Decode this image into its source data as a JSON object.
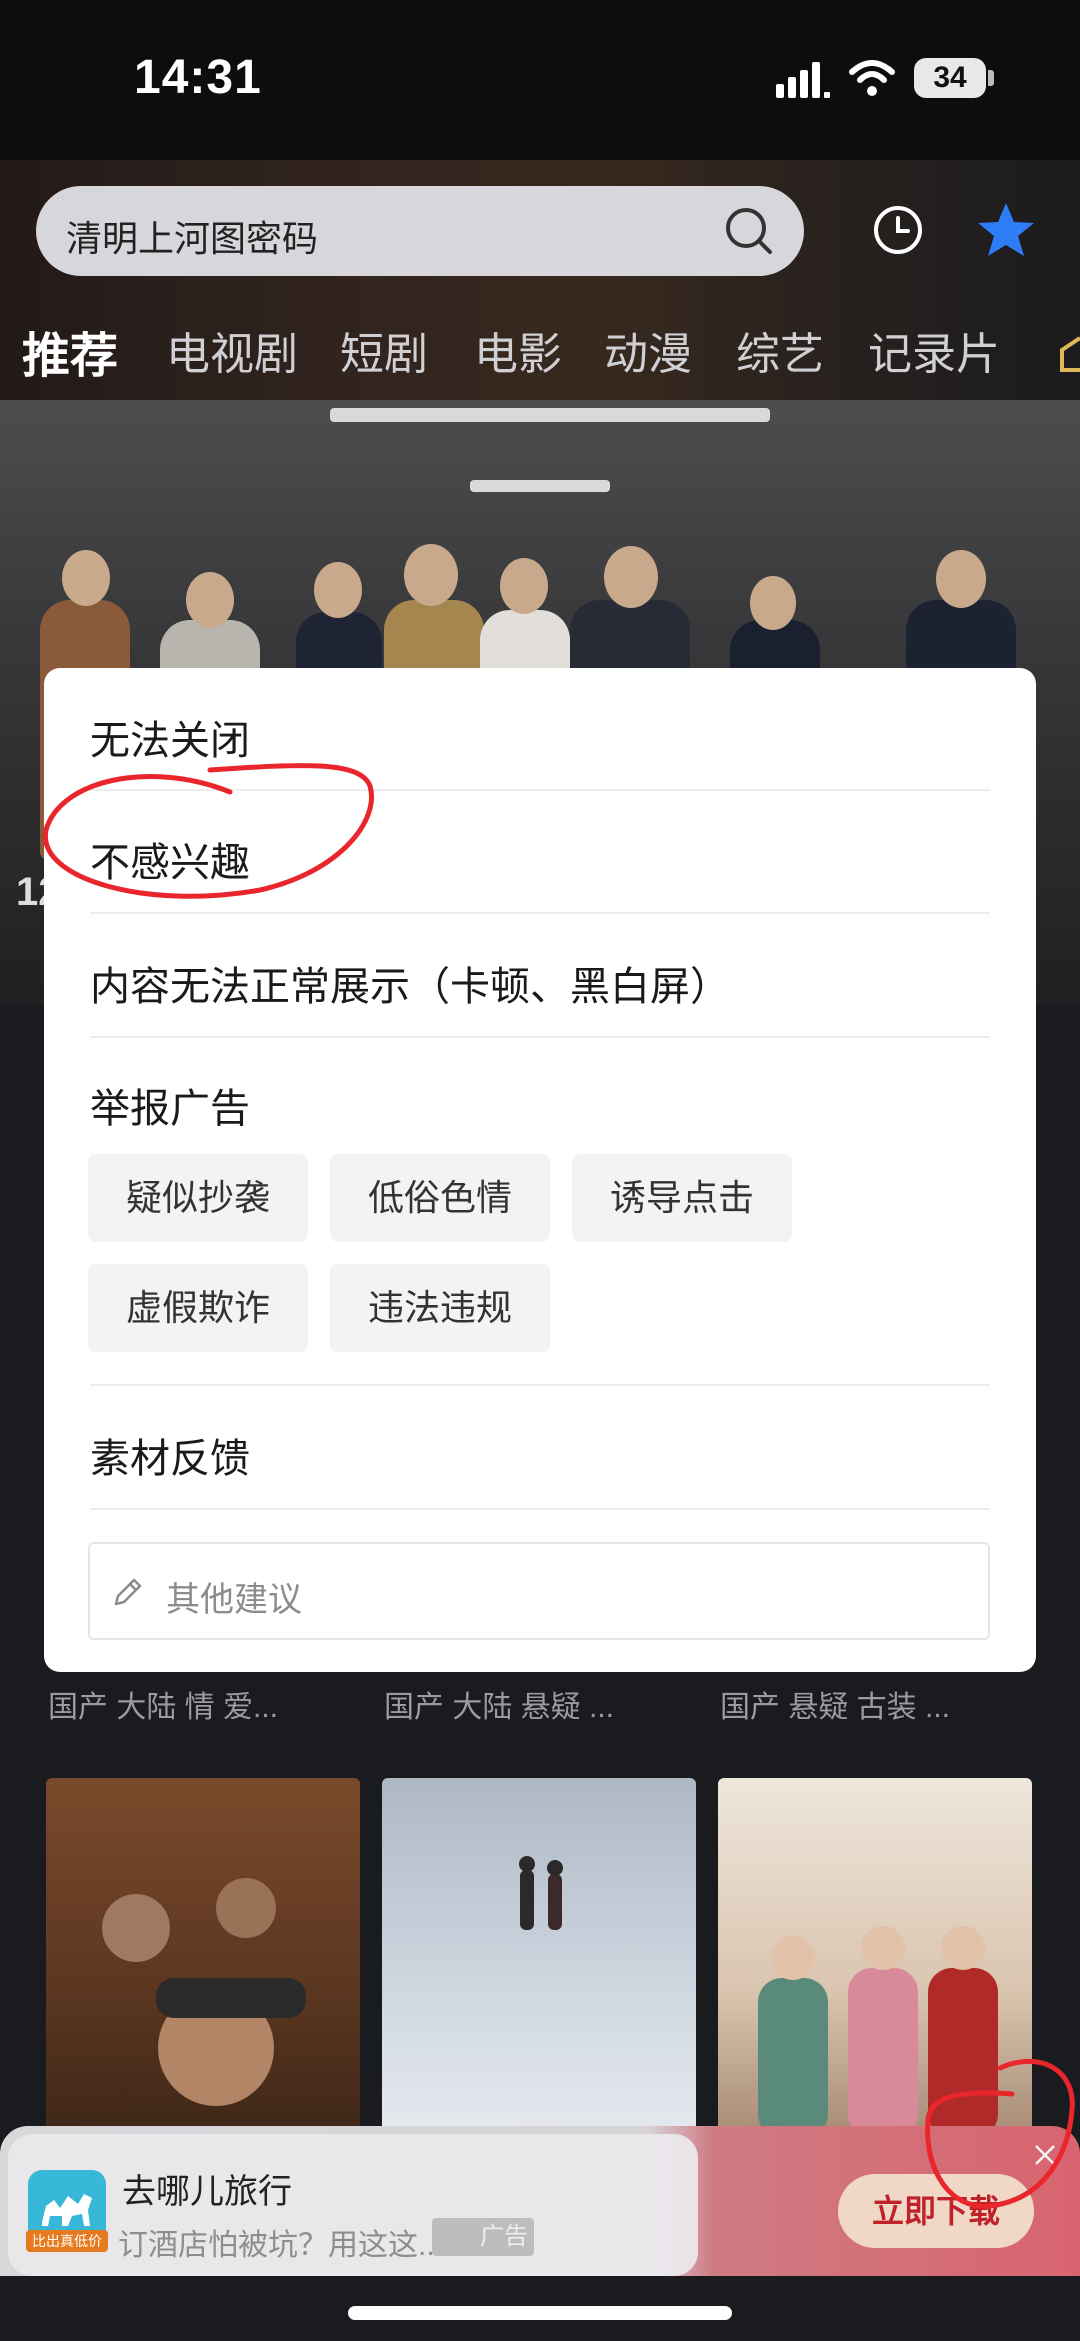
{
  "status_bar": {
    "time": "14:31",
    "battery": "34"
  },
  "search": {
    "text": "清明上河图密码",
    "icon": "search-icon"
  },
  "header_icons": {
    "history": "clock-icon",
    "favorites": "star-icon"
  },
  "tabs": [
    "推荐",
    "电视剧",
    "短剧",
    "电影",
    "动漫",
    "综艺",
    "记录片"
  ],
  "hero": {
    "number_partial": "12"
  },
  "dialog": {
    "item_1": "无法关闭",
    "item_2": "不感兴趣",
    "item_3": "内容无法正常展示（卡顿、黑白屏）",
    "report_title": "举报广告",
    "report_chips": [
      "疑似抄袭",
      "低俗色情",
      "诱导点击",
      "虚假欺诈",
      "违法违规"
    ],
    "material_feedback": "素材反馈",
    "suggestion_placeholder": "其他建议"
  },
  "row": {
    "captions": [
      "国产 大陆 情 爱...",
      "国产 大陆 悬疑 ...",
      "国产 悬疑 古装 ..."
    ]
  },
  "ad": {
    "title": "去哪儿旅行",
    "description": "订酒店怕被坑？用这这...",
    "badge": "广告",
    "logo_tag": "比出真低价",
    "cta": "立即下载"
  },
  "colors": {
    "accent_blue": "#2f7df6",
    "annotation_red": "#e8262b",
    "ad_cta_text": "#c0222b"
  }
}
